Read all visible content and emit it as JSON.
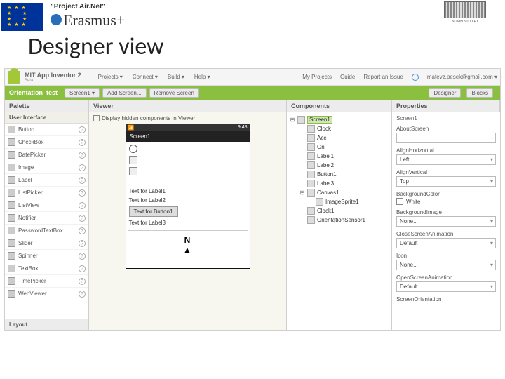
{
  "slide": {
    "project": "\"Project Air.Net\"",
    "erasmus": "Erasmus",
    "plus": "+",
    "partner_caption": "NOVIH STO LET",
    "title": "Designer view"
  },
  "topbar": {
    "app_name": "MIT App Inventor 2",
    "beta": "Beta",
    "menu": {
      "projects": "Projects ▾",
      "connect": "Connect ▾",
      "build": "Build ▾",
      "help": "Help ▾"
    },
    "right": {
      "myprojects": "My Projects",
      "guide": "Guide",
      "report": "Report an Issue",
      "user": "matevz.pesek@gmail.com ▾"
    }
  },
  "greenbar": {
    "project": "Orientation_test",
    "screen_btn": "Screen1 ▾",
    "add_btn": "Add Screen...",
    "remove_btn": "Remove Screen",
    "designer_btn": "Designer",
    "blocks_btn": "Blocks"
  },
  "panels": {
    "palette": "Palette",
    "viewer": "Viewer",
    "components": "Components",
    "properties": "Properties"
  },
  "palette": {
    "section_ui": "User Interface",
    "section_layout": "Layout",
    "items": [
      {
        "label": "Button"
      },
      {
        "label": "CheckBox"
      },
      {
        "label": "DatePicker"
      },
      {
        "label": "Image"
      },
      {
        "label": "Label"
      },
      {
        "label": "ListPicker"
      },
      {
        "label": "ListView"
      },
      {
        "label": "Notifier"
      },
      {
        "label": "PasswordTextBox"
      },
      {
        "label": "Slider"
      },
      {
        "label": "Spinner"
      },
      {
        "label": "TextBox"
      },
      {
        "label": "TimePicker"
      },
      {
        "label": "WebViewer"
      }
    ]
  },
  "viewer": {
    "hidden_label": "Display hidden components in Viewer",
    "phone_time": "9:48",
    "phone_title": "Screen1",
    "label1": "Text for Label1",
    "label2": "Text for Label2",
    "button1": "Text for Button1",
    "label3": "Text for Label3",
    "canvas_text": "N"
  },
  "components": {
    "root": "Screen1",
    "items": [
      {
        "label": "Clock"
      },
      {
        "label": "Acc"
      },
      {
        "label": "Ori"
      },
      {
        "label": "Label1"
      },
      {
        "label": "Label2"
      },
      {
        "label": "Button1"
      },
      {
        "label": "Label3"
      },
      {
        "label": "Canvas1"
      },
      {
        "label": "ImageSprite1",
        "child": true
      },
      {
        "label": "Clock1"
      },
      {
        "label": "OrientationSensor1"
      }
    ]
  },
  "properties": {
    "head": "Screen1",
    "aboutscreen": {
      "label": "AboutScreen",
      "value": ""
    },
    "alignH": {
      "label": "AlignHorizontal",
      "value": "Left"
    },
    "alignV": {
      "label": "AlignVertical",
      "value": "Top"
    },
    "bgcolor": {
      "label": "BackgroundColor",
      "value": "White"
    },
    "bgimage": {
      "label": "BackgroundImage",
      "value": "None..."
    },
    "closeanim": {
      "label": "CloseScreenAnimation",
      "value": "Default"
    },
    "icon": {
      "label": "Icon",
      "value": "None..."
    },
    "openanim": {
      "label": "OpenScreenAnimation",
      "value": "Default"
    },
    "orientation": {
      "label": "ScreenOrientation"
    }
  }
}
